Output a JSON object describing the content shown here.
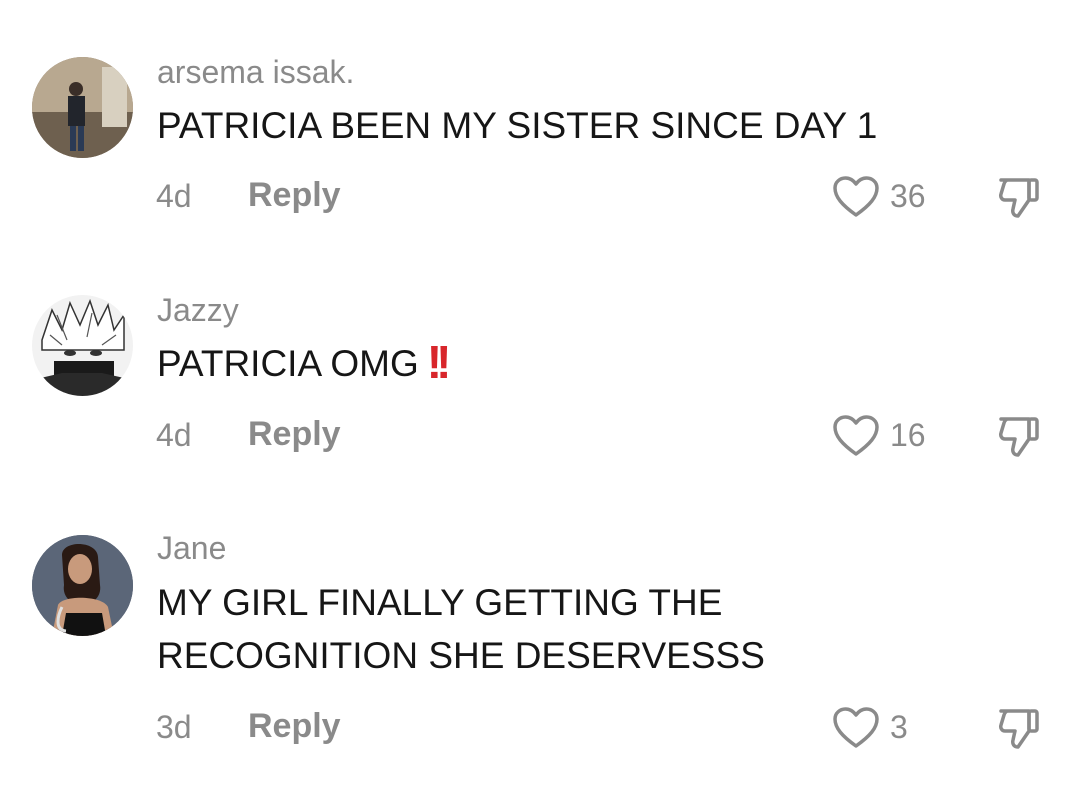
{
  "comments": [
    {
      "username": "arsema issak.",
      "text": "PATRICIA BEEN MY SISTER SINCE DAY 1",
      "time": "4d",
      "reply_label": "Reply",
      "likes": "36"
    },
    {
      "username": "Jazzy",
      "text": "PATRICIA OMG",
      "emoji": "!!",
      "time": "4d",
      "reply_label": "Reply",
      "likes": "16"
    },
    {
      "username": "Jane",
      "text_line1": "MY GIRL FINALLY GETTING THE",
      "text_line2": "RECOGNITION SHE DESERVESSS",
      "time": "3d",
      "reply_label": "Reply",
      "likes": "3"
    }
  ],
  "icons": {
    "like": "heart-outline-icon",
    "dislike": "thumbs-down-outline-icon"
  },
  "colors": {
    "meta_text": "#8a8a8a",
    "body_text": "#161616",
    "emoji_red": "#d8262b"
  }
}
